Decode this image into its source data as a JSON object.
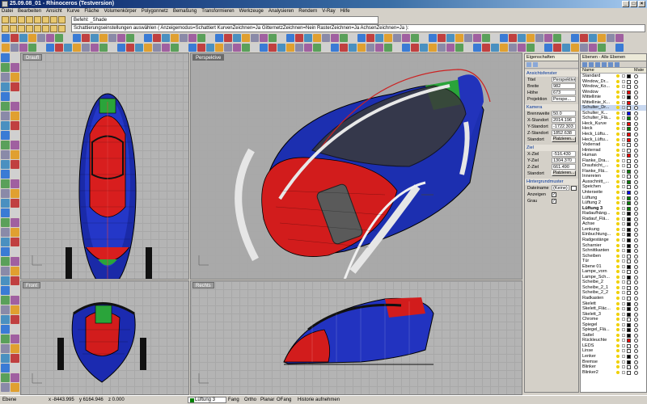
{
  "window": {
    "title": "25.09.08_01 - Rhinoceros (Testversion)"
  },
  "menu": [
    "Datei",
    "Bearbeiten",
    "Ansicht",
    "Kurve",
    "Fläche",
    "Volumenkörper",
    "Polygonnetz",
    "Bemaßung",
    "Transformieren",
    "Werkzeuge",
    "Analysieren",
    "Rendern",
    "V-Ray",
    "Hilfe"
  ],
  "command": {
    "history": "Befehl: _Shade",
    "prompt": "Schattierungseinstellungen auswählen ( Anzeigemodus=Schattiert  KurvenZeichnen=Ja  GitternetzZeichnen=Nein  RasterZeichnen=Ja  AchsenZeichnen=Ja ):"
  },
  "viewports": {
    "top": "Draufl",
    "perspective": "Perspektive",
    "front": "Front",
    "right": "Rechts"
  },
  "properties": {
    "title": "Eigenschaften",
    "section_view": "Ansichtsfenster",
    "title_label": "Titel",
    "title_value": "Perspektive",
    "width_label": "Breite",
    "width_value": "982",
    "height_label": "Höhe",
    "height_value": "673",
    "projection_label": "Projektion",
    "projection_value": "Perspe...",
    "section_camera": "Kamera",
    "focal_label": "Brennweite",
    "focal_value": "50.0",
    "xpos_label": "X-Standort",
    "xpos_value": "2014.196",
    "ypos_label": "Y-Standort",
    "ypos_value": "-1722.303",
    "zpos_label": "Z-Standort",
    "zpos_value": "1852.638",
    "location_label": "Standort",
    "place_button": "Platzieren...",
    "section_target": "Ziel",
    "xtarget_label": "X-Ziel",
    "xtarget_value": "-516.430",
    "ytarget_label": "Y-Ziel",
    "ytarget_value": "1304.370",
    "ztarget_label": "Z-Ziel",
    "ztarget_value": "661.490",
    "target_location_label": "Standort",
    "target_place_button": "Platzieren...",
    "section_background": "Hintergrundmuster",
    "filename_label": "Dateiname",
    "filename_value": "(Keine)",
    "show_label": "Anzeigen",
    "gray_label": "Grau",
    "check": "✓"
  },
  "layers": {
    "title": "Ebenen - Alle Ebenen",
    "col_name": "Name",
    "col_material": "Mate",
    "items": [
      {
        "name": "Standard",
        "color": "#000000"
      },
      {
        "name": "Window_Dr...",
        "color": "#ffffff"
      },
      {
        "name": "Window_Ko...",
        "color": "#ffffff"
      },
      {
        "name": "Window",
        "color": "#ff0000"
      },
      {
        "name": "Mittellinie",
        "color": "#000000"
      },
      {
        "name": "Mittellinie_K...",
        "color": "#ff0000"
      },
      {
        "name": "Schulter_Dr...",
        "color": "#ffffff"
      },
      {
        "name": "Schulter_K...",
        "color": "#0000ff"
      },
      {
        "name": "Schulter_Flä...",
        "color": "#008000"
      },
      {
        "name": "Heck_Kurve",
        "color": "#ff0000"
      },
      {
        "name": "Heck",
        "color": "#008000"
      },
      {
        "name": "Heck_Lüftu...",
        "color": "#ff0000"
      },
      {
        "name": "Heck_Lüftu...",
        "color": "#ff0000"
      },
      {
        "name": "Voderrad",
        "color": "#ffffff"
      },
      {
        "name": "Hinterrad",
        "color": "#ffffff"
      },
      {
        "name": "Human",
        "color": "#ff0000"
      },
      {
        "name": "Flanke_Dra...",
        "color": "#ffffff"
      },
      {
        "name": "Draufsicht_...",
        "color": "#ffffff"
      },
      {
        "name": "Flanke_Flä...",
        "color": "#008000"
      },
      {
        "name": "Innereien",
        "color": "#ffffff"
      },
      {
        "name": "Ausschnitt_...",
        "color": "#008000"
      },
      {
        "name": "Speichen",
        "color": "#ffffff"
      },
      {
        "name": "Unterseite",
        "color": "#0000ff"
      },
      {
        "name": "Lüftung",
        "color": "#008000"
      },
      {
        "name": "Lüftung 2",
        "color": "#008000"
      },
      {
        "name": "Lüftung 3",
        "color": "#008000"
      },
      {
        "name": "Radaufhäng...",
        "color": "#000000"
      },
      {
        "name": "Radauf_Flä...",
        "color": "#000000"
      },
      {
        "name": "Achse",
        "color": "#000000"
      },
      {
        "name": "Lenkung",
        "color": "#000000"
      },
      {
        "name": "Einbuchtung...",
        "color": "#000000"
      },
      {
        "name": "Radgestänge",
        "color": "#000000"
      },
      {
        "name": "Scharnier",
        "color": "#000000"
      },
      {
        "name": "Schnittkanten",
        "color": "#000000"
      },
      {
        "name": "Scheiben",
        "color": "#ffffff"
      },
      {
        "name": "Tür",
        "color": "#ffffff"
      },
      {
        "name": "Ebene 01",
        "color": "#000000"
      },
      {
        "name": "Lampe_vorn",
        "color": "#ffffff"
      },
      {
        "name": "Lampe_Sch...",
        "color": "#000000"
      },
      {
        "name": "Scheibe_2",
        "color": "#ffffff"
      },
      {
        "name": "Scheibe_2_1",
        "color": "#ffffff"
      },
      {
        "name": "Scheibe_2_2",
        "color": "#ffffff"
      },
      {
        "name": "Radkasten",
        "color": "#ffffff"
      },
      {
        "name": "Skelett",
        "color": "#000000"
      },
      {
        "name": "Skelett_Fläc...",
        "color": "#000000"
      },
      {
        "name": "Skelett_3",
        "color": "#000000"
      },
      {
        "name": "Chrome",
        "color": "#ffffff"
      },
      {
        "name": "Spiegel",
        "color": "#000000"
      },
      {
        "name": "Spiegel_Flä...",
        "color": "#000000"
      },
      {
        "name": "Sattel",
        "color": "#000000"
      },
      {
        "name": "Rückleuchte",
        "color": "#ff0000"
      },
      {
        "name": "LEDS",
        "color": "#ffffff"
      },
      {
        "name": "Linse",
        "color": "#ffffff"
      },
      {
        "name": "Lenker",
        "color": "#000000"
      },
      {
        "name": "Bremse",
        "color": "#000000"
      },
      {
        "name": "Blinker",
        "color": "#ffffff"
      },
      {
        "name": "Blinker2",
        "color": "#ffffff"
      }
    ]
  },
  "status": {
    "units": "Ebene",
    "x": "x -8443.995",
    "y": "y 6164.946",
    "z": "z 0.000",
    "current_layer": "Lüftung 3",
    "snap": "Fang",
    "ortho": "Ortho",
    "planar": "Planar",
    "osnap": "OFang",
    "history": "Historie aufnehmen"
  }
}
